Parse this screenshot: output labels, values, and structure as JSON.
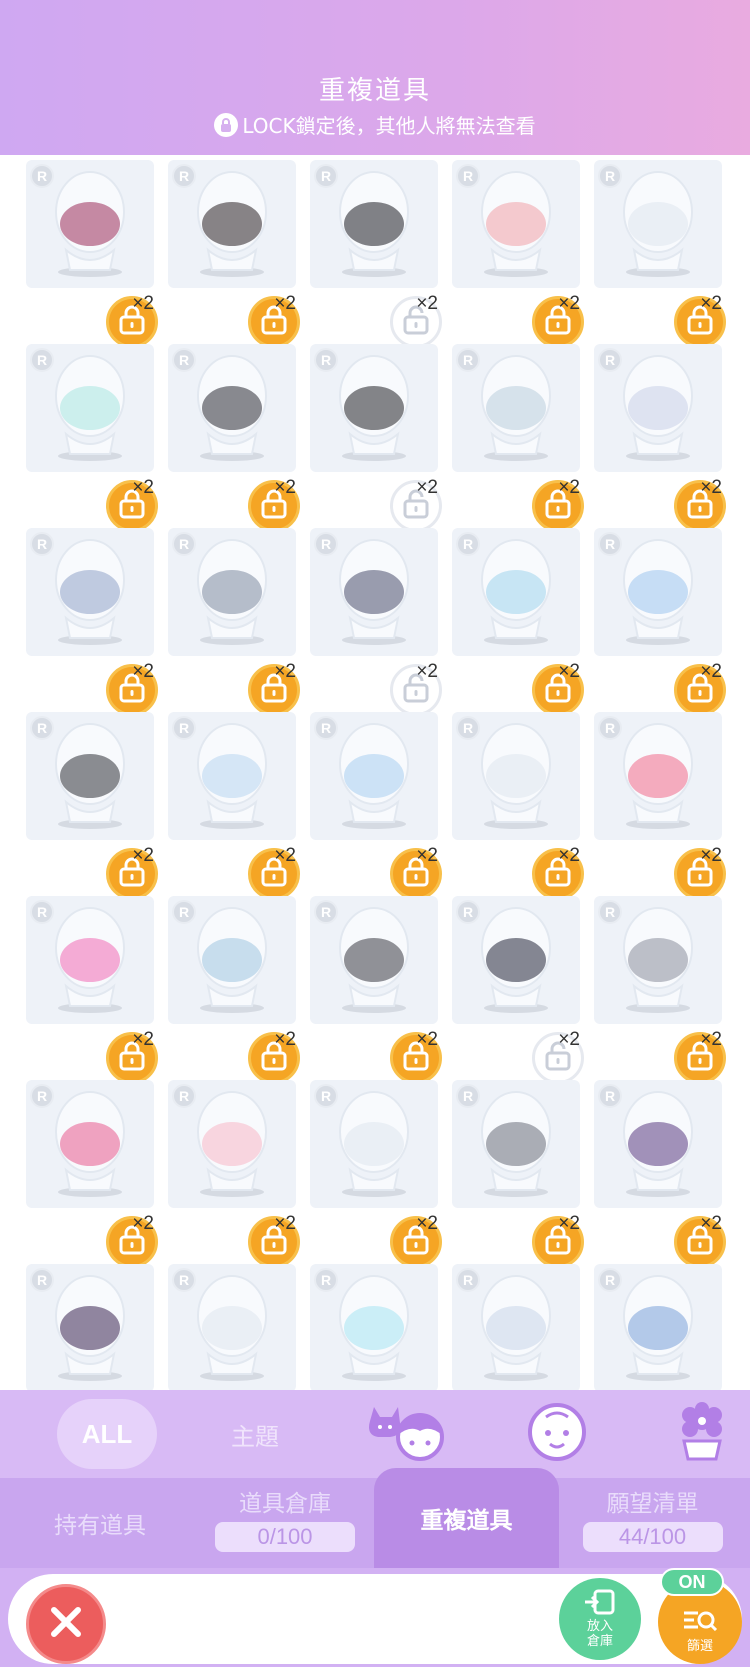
{
  "header": {
    "title": "重複道具",
    "subtitle": "LOCK鎖定後，其他人將無法查看"
  },
  "grid": {
    "rarity_badge": "R",
    "items": [
      {
        "count": "×2",
        "locked": true,
        "icon": "mask-item-icon",
        "accent": "#9b2b5a"
      },
      {
        "count": "×2",
        "locked": true,
        "icon": "black-hood-icon",
        "accent": "#2a2025"
      },
      {
        "count": "×2",
        "locked": false,
        "icon": "black-hat-icon",
        "accent": "#1e1e24"
      },
      {
        "count": "×2",
        "locked": true,
        "icon": "blush-icon",
        "accent": "#f1a0a8"
      },
      {
        "count": "×2",
        "locked": true,
        "icon": "blank-mannequin-icon",
        "accent": "#dfe6ef"
      },
      {
        "count": "×2",
        "locked": true,
        "icon": "mint-hair-icon",
        "accent": "#a8e6e0"
      },
      {
        "count": "×2",
        "locked": true,
        "icon": "frilly-dress-icon",
        "accent": "#2b2b35"
      },
      {
        "count": "×2",
        "locked": false,
        "icon": "black-bunny-hood-icon",
        "accent": "#222228"
      },
      {
        "count": "×2",
        "locked": true,
        "icon": "blue-aura-icon",
        "accent": "#b9cddc"
      },
      {
        "count": "×2",
        "locked": true,
        "icon": "glass-bottle-icon",
        "accent": "#c9cfe8"
      },
      {
        "count": "×2",
        "locked": true,
        "icon": "blue-jacket-icon",
        "accent": "#8fa3c8"
      },
      {
        "count": "×2",
        "locked": true,
        "icon": "sword-icon",
        "accent": "#7e8aa0"
      },
      {
        "count": "×2",
        "locked": false,
        "icon": "doll-companion-icon",
        "accent": "#4a4f6e"
      },
      {
        "count": "×2",
        "locked": true,
        "icon": "cloud-halo-icon",
        "accent": "#9fd3ec"
      },
      {
        "count": "×2",
        "locked": true,
        "icon": "jellyfish-hair-icon",
        "accent": "#9cc4ee"
      },
      {
        "count": "×2",
        "locked": true,
        "icon": "black-bob-hair-icon",
        "accent": "#2f3138"
      },
      {
        "count": "×2",
        "locked": true,
        "icon": "blue-frill-dress-icon",
        "accent": "#b8d6f0"
      },
      {
        "count": "×2",
        "locked": true,
        "icon": "plaid-dress-icon",
        "accent": "#a8cdf0"
      },
      {
        "count": "×2",
        "locked": true,
        "icon": "closed-eyes-icon",
        "accent": "#dfe6ef"
      },
      {
        "count": "×2",
        "locked": true,
        "icon": "red-tongue-icon",
        "accent": "#f06a8a"
      },
      {
        "count": "×2",
        "locked": true,
        "icon": "sticker-swarm-icon",
        "accent": "#f06ab4"
      },
      {
        "count": "×2",
        "locked": true,
        "icon": "flower-wreath-icon",
        "accent": "#9ec4e0"
      },
      {
        "count": "×2",
        "locked": true,
        "icon": "horns-icon",
        "accent": "#3a3a44"
      },
      {
        "count": "×2",
        "locked": false,
        "icon": "cat-cloak-icon",
        "accent": "#24263a"
      },
      {
        "count": "×2",
        "locked": true,
        "icon": "feather-cape-icon",
        "accent": "#8a8e9c"
      },
      {
        "count": "×2",
        "locked": true,
        "icon": "pink-bubble-icon",
        "accent": "#e8598e"
      },
      {
        "count": "×2",
        "locked": true,
        "icon": "pink-plush-icon",
        "accent": "#f7b6c6"
      },
      {
        "count": "×2",
        "locked": true,
        "icon": "tiny-mouth-icon",
        "accent": "#dfe6ef"
      },
      {
        "count": "×2",
        "locked": true,
        "icon": "wand-icon",
        "accent": "#6a6e7a"
      },
      {
        "count": "×2",
        "locked": true,
        "icon": "purple-cape-icon",
        "accent": "#5a3a82"
      },
      {
        "count": "",
        "locked": true,
        "icon": "purple-gothic-dress-icon",
        "accent": "#3a2452"
      },
      {
        "count": "",
        "locked": true,
        "icon": "blank-mannequin-icon",
        "accent": "#dfe6ef"
      },
      {
        "count": "",
        "locked": false,
        "icon": "glowing-eyes-icon",
        "accent": "#a6e4f2"
      },
      {
        "count": "",
        "locked": true,
        "icon": "wings-icon",
        "accent": "#c8d6ea"
      },
      {
        "count": "",
        "locked": true,
        "icon": "blue-ruffle-skirt-icon",
        "accent": "#7aa0d8"
      }
    ]
  },
  "categories": {
    "all_label": "ALL",
    "theme_label": "主題"
  },
  "tabs": {
    "owned_label": "持有道具",
    "storage_label": "道具倉庫",
    "storage_count": "0/100",
    "duplicate_label": "重複道具",
    "wishlist_label": "願望清單",
    "wishlist_count": "44/100"
  },
  "footer": {
    "store_label_1": "放入",
    "store_label_2": "倉庫",
    "filter_label": "篩選",
    "on_badge": "ON"
  },
  "colors": {
    "accent": "#f5a524",
    "header_gradient_start": "#cfa8f2",
    "header_gradient_end": "#e9abe0",
    "tab_bg": "#c9a6ef",
    "close": "#ec5d5d",
    "store": "#5cd19a"
  }
}
